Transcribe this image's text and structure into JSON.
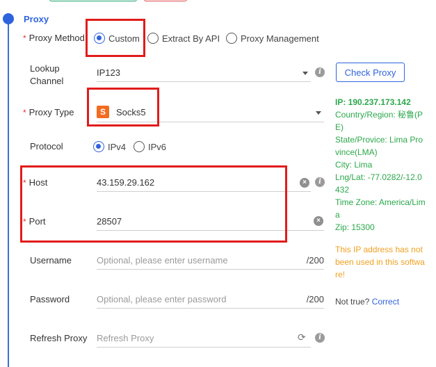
{
  "section": {
    "title": "Proxy"
  },
  "proxy_method": {
    "label": "Proxy Method",
    "options": [
      "Custom",
      "Extract By API",
      "Proxy Management"
    ],
    "selected": "Custom"
  },
  "lookup_channel": {
    "label_line1": "Lookup",
    "label_line2": "Channel",
    "value": "IP123"
  },
  "check_proxy": {
    "label": "Check Proxy"
  },
  "proxy_type": {
    "label": "Proxy Type",
    "value": "Socks5",
    "badge": "S"
  },
  "protocol": {
    "label": "Protocol",
    "options": [
      "IPv4",
      "IPv6"
    ],
    "selected": "IPv4"
  },
  "host": {
    "label": "Host",
    "value": "43.159.29.162"
  },
  "port": {
    "label": "Port",
    "value": "28507"
  },
  "username": {
    "label": "Username",
    "placeholder": "Optional, please enter username",
    "counter": "/200"
  },
  "password": {
    "label": "Password",
    "placeholder": "Optional, please enter password",
    "counter": "/200"
  },
  "refresh_proxy": {
    "label": "Refresh Proxy",
    "placeholder": "Refresh Proxy"
  },
  "ip_info": {
    "ip": "IP:  190.237.173.142",
    "country": "Country/Region: 秘鲁(PE)",
    "state": "State/Provice: Lima Province(LMA)",
    "city": "City: Lima",
    "lnglat": "Lng/Lat: -77.0282/-12.0432",
    "timezone": "Time Zone: America/Lima",
    "zip": "Zip: 15300"
  },
  "warning": "This IP address has not been used in this software!",
  "not_true": {
    "text": "Not true?",
    "link": "Correct"
  },
  "colors": {
    "accent": "#2f63dd",
    "success": "#2aa84a",
    "warning": "#f0a020",
    "required": "#e6322f",
    "highlight": "#e21b1b",
    "badge": "#f26b21"
  }
}
